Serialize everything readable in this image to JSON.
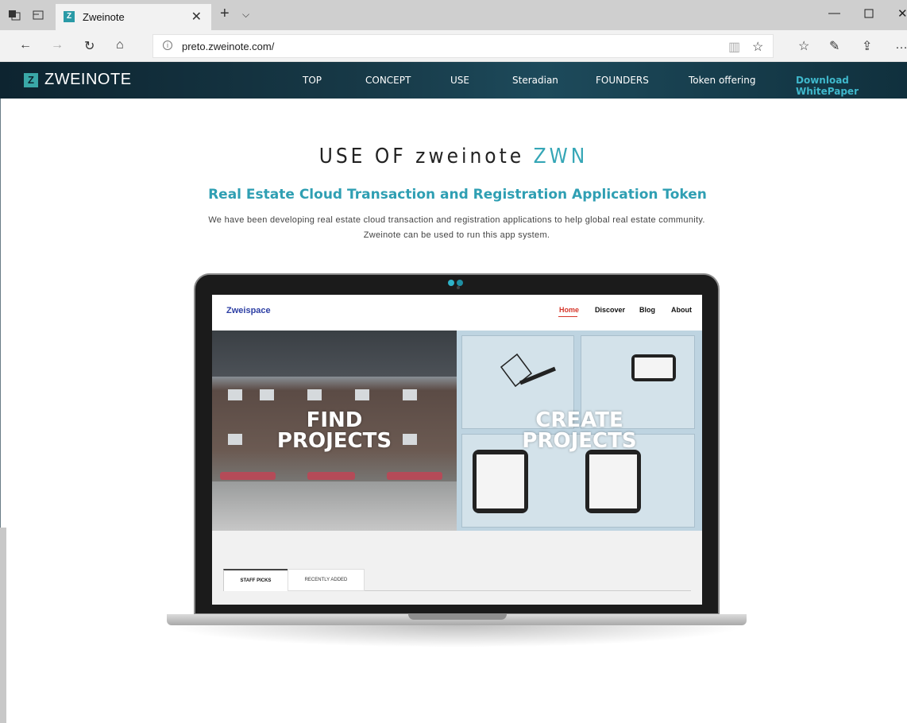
{
  "browser": {
    "tab_title": "Zweinote",
    "tab_favicon": "Z",
    "url": "preto.zweinote.com/"
  },
  "site": {
    "logo_mark": "Z",
    "logo_text": "ZWEINOTE",
    "nav": [
      "TOP",
      "CONCEPT",
      "USE",
      "Steradian",
      "FOUNDERS",
      "Token offering",
      "Download WhitePaper"
    ],
    "accent_color": "#35a6b6"
  },
  "content": {
    "heading_main": "USE OF zweinote",
    "heading_accent": "ZWN",
    "subheading": "Real Estate Cloud Transaction and Registration Application Token",
    "paragraph_line1": "We have been developing real estate cloud transaction and registration applications to help global real estate community.",
    "paragraph_line2": "Zweinote can be used to run this app system."
  },
  "screen_app": {
    "logo": "Zweispace",
    "nav": [
      "Home",
      "Discover",
      "Blog",
      "About"
    ],
    "hero_left_line1": "FIND",
    "hero_left_line2": "PROJECTS",
    "hero_right_line1": "CREATE",
    "hero_right_line2": "PROJECTS",
    "tab_active": "STAFF PICKS",
    "tab_inactive": "RECENTLY ADDED"
  }
}
